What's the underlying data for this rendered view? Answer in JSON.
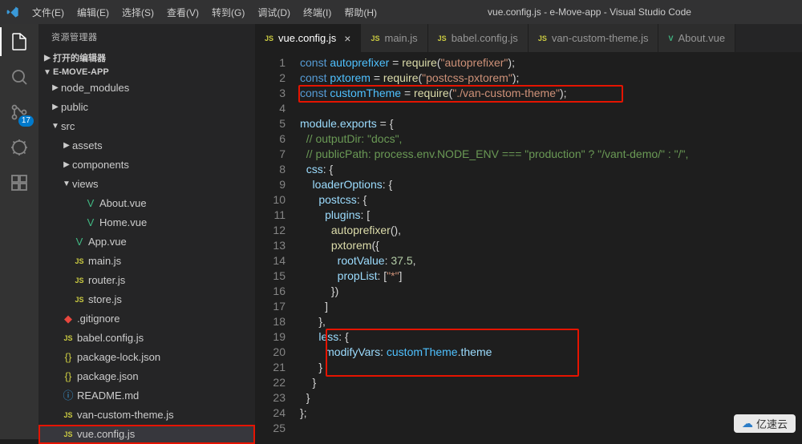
{
  "menubar": {
    "items": [
      "文件(E)",
      "编辑(E)",
      "选择(S)",
      "查看(V)",
      "转到(G)",
      "调试(D)",
      "终端(I)",
      "帮助(H)"
    ],
    "title": "vue.config.js - e-Move-app - Visual Studio Code"
  },
  "activitybar": {
    "scm_badge": "17"
  },
  "sidebar": {
    "title": "资源管理器",
    "sections": {
      "open_editors": "打开的编辑器",
      "project": "E-MOVE-APP"
    },
    "tree": {
      "node_modules": "node_modules",
      "public": "public",
      "src": "src",
      "assets": "assets",
      "components": "components",
      "views": "views",
      "about_vue": "About.vue",
      "home_vue": "Home.vue",
      "app_vue": "App.vue",
      "main_js": "main.js",
      "router_js": "router.js",
      "store_js": "store.js",
      "gitignore": ".gitignore",
      "babel": "babel.config.js",
      "pkg_lock": "package-lock.json",
      "pkg": "package.json",
      "readme": "README.md",
      "van_theme": "van-custom-theme.js",
      "vue_config": "vue.config.js"
    }
  },
  "tabs": [
    {
      "icon": "JS",
      "icon_class": "icon-js",
      "label": "vue.config.js",
      "active": true,
      "close": true
    },
    {
      "icon": "JS",
      "icon_class": "icon-js",
      "label": "main.js",
      "active": false
    },
    {
      "icon": "JS",
      "icon_class": "icon-js",
      "label": "babel.config.js",
      "active": false
    },
    {
      "icon": "JS",
      "icon_class": "icon-js",
      "label": "van-custom-theme.js",
      "active": false
    },
    {
      "icon": "V",
      "icon_class": "icon-vue",
      "label": "About.vue",
      "active": false
    }
  ],
  "code": {
    "l1": {
      "kw": "const",
      "var": " autoprefixer",
      "eq": " = ",
      "fn": "require",
      "p1": "(",
      "str": "\"autoprefixer\"",
      "p2": ");"
    },
    "l2": {
      "kw": "const",
      "var": " pxtorem",
      "eq": " = ",
      "fn": "require",
      "p1": "(",
      "str": "\"postcss-pxtorem\"",
      "p2": ");"
    },
    "l3": {
      "kw": "const",
      "var": " customTheme",
      "eq": " = ",
      "fn": "require",
      "p1": "(",
      "str": "\"./van-custom-theme\"",
      "p2": ");"
    },
    "l5": {
      "a": "module",
      "b": ".",
      "c": "exports",
      "d": " = {"
    },
    "l6": "  // outputDir: \"docs\",",
    "l7": "  // publicPath: process.env.NODE_ENV === \"production\" ? \"/vant-demo/\" : \"/\",",
    "l8": {
      "prop": "  css",
      "p": ": {"
    },
    "l9": {
      "prop": "    loaderOptions",
      "p": ": {"
    },
    "l10": {
      "prop": "      postcss",
      "p": ": {"
    },
    "l11": {
      "prop": "        plugins",
      "p": ": ["
    },
    "l12": {
      "fn": "          autoprefixer",
      "p": "(),"
    },
    "l13": {
      "fn": "          pxtorem",
      "p": "({"
    },
    "l14": {
      "prop": "            rootValue",
      "p": ": ",
      "num": "37.5",
      "p2": ","
    },
    "l15": {
      "prop": "            propList",
      "p": ": [",
      "str": "\"*\"",
      "p2": "]"
    },
    "l16": "          })",
    "l17": "        ]",
    "l18": "      },",
    "l19": {
      "prop": "      less",
      "p": ": {"
    },
    "l20": {
      "prop": "        modifyVars",
      "p": ": ",
      "var": "customTheme",
      "p2": ".",
      "prop2": "theme"
    },
    "l21": "      }",
    "l22": "    }",
    "l23": "  }",
    "l24": "};"
  },
  "watermark": "亿速云"
}
